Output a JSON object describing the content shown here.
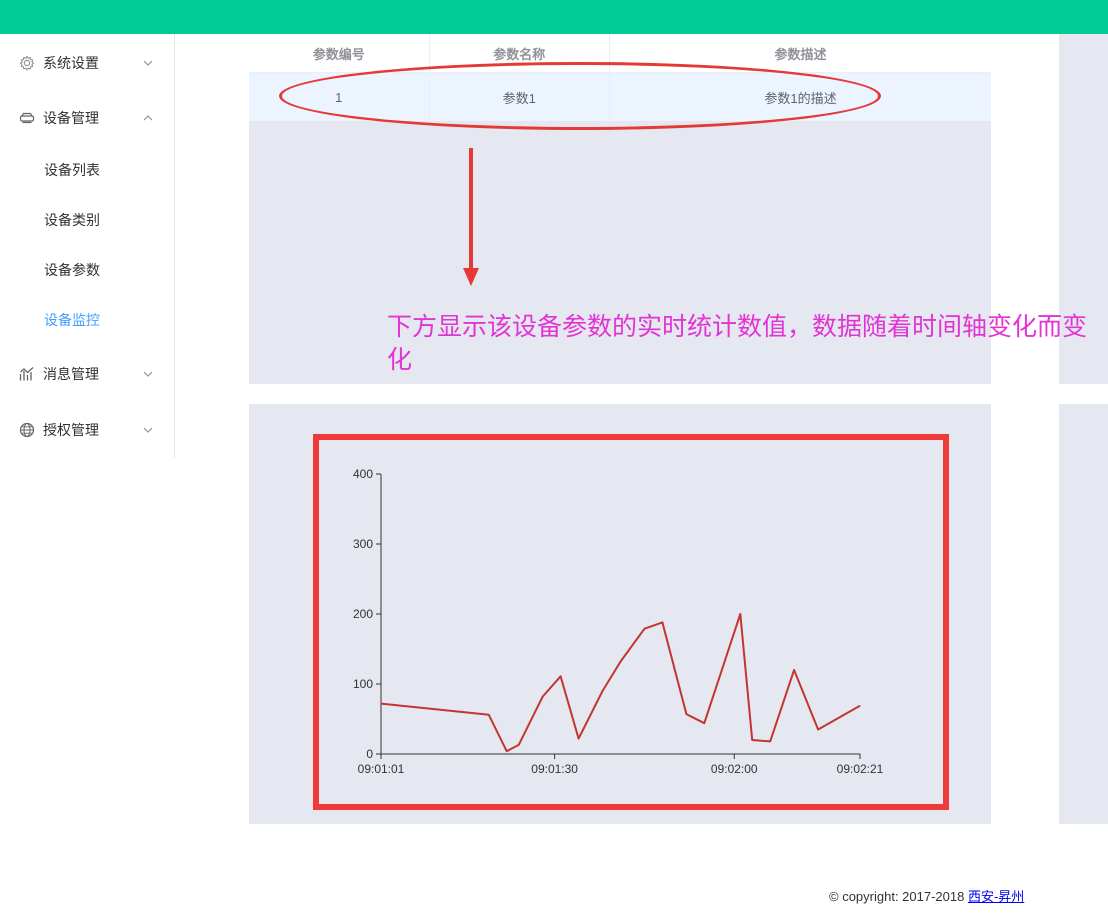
{
  "sidebar": {
    "items": [
      {
        "label": "系统设置",
        "icon": "gear-icon",
        "expanded": false
      },
      {
        "label": "设备管理",
        "icon": "device-icon",
        "expanded": true
      },
      {
        "label": "消息管理",
        "icon": "chart-icon",
        "expanded": false
      },
      {
        "label": "授权管理",
        "icon": "globe-icon",
        "expanded": false
      }
    ],
    "sub_items": [
      {
        "label": "设备列表",
        "active": false
      },
      {
        "label": "设备类别",
        "active": false
      },
      {
        "label": "设备参数",
        "active": false
      },
      {
        "label": "设备监控",
        "active": true
      }
    ]
  },
  "table": {
    "headers": [
      "参数编号",
      "参数名称",
      "参数描述"
    ],
    "rows": [
      [
        "1",
        "参数1",
        "参数1的描述"
      ]
    ]
  },
  "annotation": {
    "text": "下方显示该设备参数的实时统计数值，数据随着时间轴变化而变化"
  },
  "chart_data": {
    "type": "line",
    "x_tick_labels": [
      "09:01:01",
      "09:01:30",
      "09:02:00",
      "09:02:21"
    ],
    "y_tick_labels": [
      "0",
      "100",
      "200",
      "300",
      "400"
    ],
    "ylim": [
      0,
      400
    ],
    "xlim": [
      "09:01:01",
      "09:02:21"
    ],
    "x": [
      "09:01:01",
      "09:01:19",
      "09:01:22",
      "09:01:24",
      "09:01:28",
      "09:01:31",
      "09:01:34",
      "09:01:38",
      "09:01:41",
      "09:01:45",
      "09:01:48",
      "09:01:52",
      "09:01:55",
      "09:02:01",
      "09:02:03",
      "09:02:06",
      "09:02:10",
      "09:02:14",
      "09:02:21"
    ],
    "series": [
      {
        "values": [
          72,
          56,
          4,
          13,
          82,
          111,
          22,
          90,
          132,
          179,
          188,
          57,
          44,
          200,
          20,
          18,
          120,
          35,
          69
        ],
        "color": "#c23531"
      }
    ],
    "grid": false
  },
  "footer": {
    "copyright": "© copyright: 2017-2018 ",
    "link_text": "西安-昇州"
  },
  "colors": {
    "header": "#00cc96",
    "accent": "#409eff",
    "annotation": "#e53935",
    "annotation_text": "#e234d4",
    "panel_bg": "#e5e8f0"
  }
}
